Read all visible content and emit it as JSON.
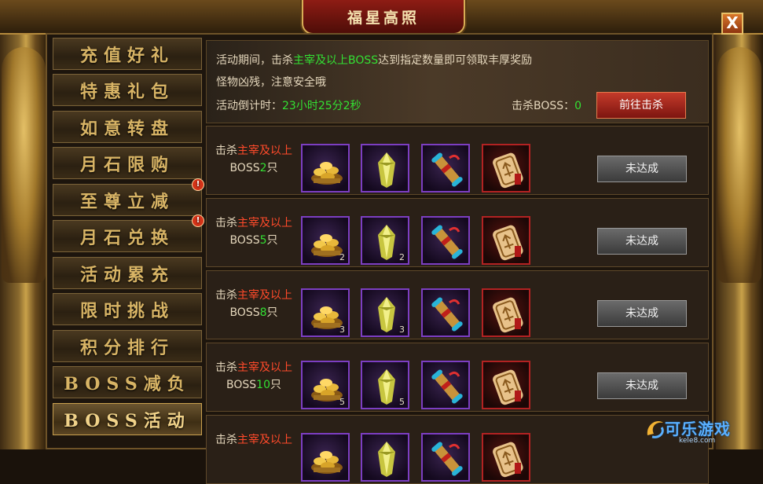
{
  "window": {
    "title": "福星高照",
    "close_label": "X"
  },
  "sidebar": {
    "items": [
      {
        "label": "充值好礼",
        "alert": false
      },
      {
        "label": "特惠礼包",
        "alert": false
      },
      {
        "label": "如意转盘",
        "alert": false
      },
      {
        "label": "月石限购",
        "alert": false
      },
      {
        "label": "至尊立减",
        "alert": true,
        "alert_mark": "!"
      },
      {
        "label": "月石兑换",
        "alert": true,
        "alert_mark": "!"
      },
      {
        "label": "活动累充",
        "alert": false
      },
      {
        "label": "限时挑战",
        "alert": false
      },
      {
        "label": "积分排行",
        "alert": false
      },
      {
        "label": "BOSS减负",
        "alert": false
      },
      {
        "label": "BOSS活动",
        "alert": false,
        "active": true
      }
    ]
  },
  "info": {
    "line1_a": "活动期间，击杀",
    "line1_b": "主宰及以上BOSS",
    "line1_c": "达到指定数量即可领取丰厚奖励",
    "line2": "怪物凶残，注意安全哦",
    "countdown_label": "活动倒计时：",
    "countdown_value": "23小时25分2秒",
    "kill_label": "击杀BOSS：",
    "kill_value": "0",
    "go_button": "前往击杀"
  },
  "rows": [
    {
      "prefix": "击杀",
      "boss_type": "主宰及以上",
      "boss_word": "BOSS",
      "count": "2",
      "suffix": "只",
      "item_counts": [
        "",
        "",
        "",
        ""
      ],
      "status": "未达成"
    },
    {
      "prefix": "击杀",
      "boss_type": "主宰及以上",
      "boss_word": "BOSS",
      "count": "5",
      "suffix": "只",
      "item_counts": [
        "2",
        "2",
        "",
        ""
      ],
      "status": "未达成"
    },
    {
      "prefix": "击杀",
      "boss_type": "主宰及以上",
      "boss_word": "BOSS",
      "count": "8",
      "suffix": "只",
      "item_counts": [
        "3",
        "3",
        "",
        ""
      ],
      "status": "未达成"
    },
    {
      "prefix": "击杀",
      "boss_type": "主宰及以上",
      "boss_word": "BOSS",
      "count": "10",
      "suffix": "只",
      "item_counts": [
        "5",
        "5",
        "",
        ""
      ],
      "status": "未达成"
    },
    {
      "prefix": "击杀",
      "boss_type": "主宰及以上",
      "boss_word": "",
      "count": "",
      "suffix": "",
      "item_counts": [
        "",
        "",
        "",
        ""
      ],
      "status": ""
    }
  ],
  "items": [
    {
      "icon": "gold-ingot-pile-icon"
    },
    {
      "icon": "yellow-crystal-icon"
    },
    {
      "icon": "scroll-icon"
    },
    {
      "icon": "gold-token-icon"
    }
  ],
  "watermark": {
    "brand": "可乐游戏",
    "url": "kele8.com"
  }
}
